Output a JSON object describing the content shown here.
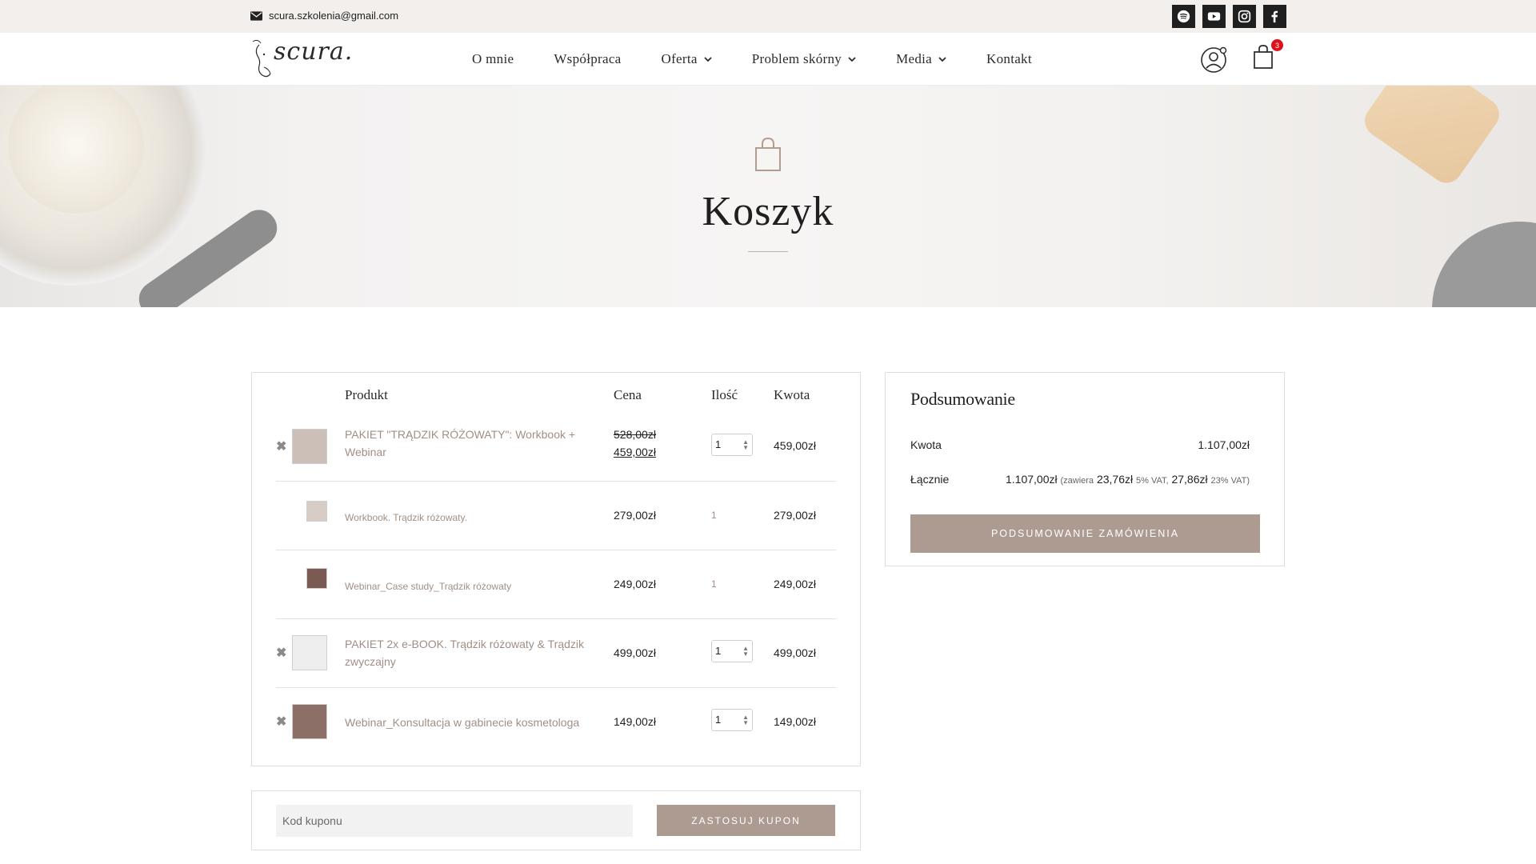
{
  "topbar": {
    "email": "scura.szkolenia@gmail.com",
    "social_icons": [
      "spotify-icon",
      "youtube-icon",
      "instagram-icon",
      "facebook-icon"
    ]
  },
  "header": {
    "logo_text": "scura.",
    "nav": [
      {
        "label": "O mnie",
        "has_dropdown": false
      },
      {
        "label": "Współpraca",
        "has_dropdown": false
      },
      {
        "label": "Oferta",
        "has_dropdown": true
      },
      {
        "label": "Problem skórny",
        "has_dropdown": true
      },
      {
        "label": "Media",
        "has_dropdown": true
      },
      {
        "label": "Kontakt",
        "has_dropdown": false
      }
    ],
    "cart_count": "3"
  },
  "hero": {
    "title": "Koszyk"
  },
  "cart": {
    "columns": {
      "product": "Produkt",
      "price": "Cena",
      "qty": "Ilość",
      "amount": "Kwota"
    },
    "rows": [
      {
        "name": "PAKIET \"TRĄDZIK RÓŻOWATY\": Workbook + Webinar",
        "price_old": "528,00zł",
        "price_new": "459,00zł",
        "qty": "1",
        "amount": "459,00zł",
        "removable": true
      },
      {
        "name": "Workbook. Trądzik różowaty.",
        "price": "279,00zł",
        "qty": "1",
        "amount": "279,00zł",
        "removable": false
      },
      {
        "name": "Webinar_Case study_Trądzik różowaty",
        "price": "249,00zł",
        "qty": "1",
        "amount": "249,00zł",
        "removable": false
      },
      {
        "name": "PAKIET 2x e-BOOK. Trądzik różowaty & Trądzik zwyczajny",
        "price": "499,00zł",
        "qty": "1",
        "amount": "499,00zł",
        "removable": true
      },
      {
        "name": "Webinar_Konsultacja w gabinecie kosmetologa",
        "price": "149,00zł",
        "qty": "1",
        "amount": "149,00zł",
        "removable": true
      }
    ],
    "remove_symbol": "✖"
  },
  "coupon": {
    "placeholder": "Kod kuponu",
    "button": "ZASTOSUJ KUPON"
  },
  "summary": {
    "title": "Podsumowanie",
    "subtotal_label": "Kwota",
    "subtotal_value": "1.107,00zł",
    "total_label": "Łącznie",
    "total_value": "1.107,00zł",
    "tax_prefix": "(zawiera",
    "tax1_value": "23,76zł",
    "tax1_label": "5% VAT,",
    "tax2_value": "27,86zł",
    "tax2_label": "23% VAT)",
    "checkout_button": "PODSUMOWANIE ZAMÓWIENIA"
  }
}
